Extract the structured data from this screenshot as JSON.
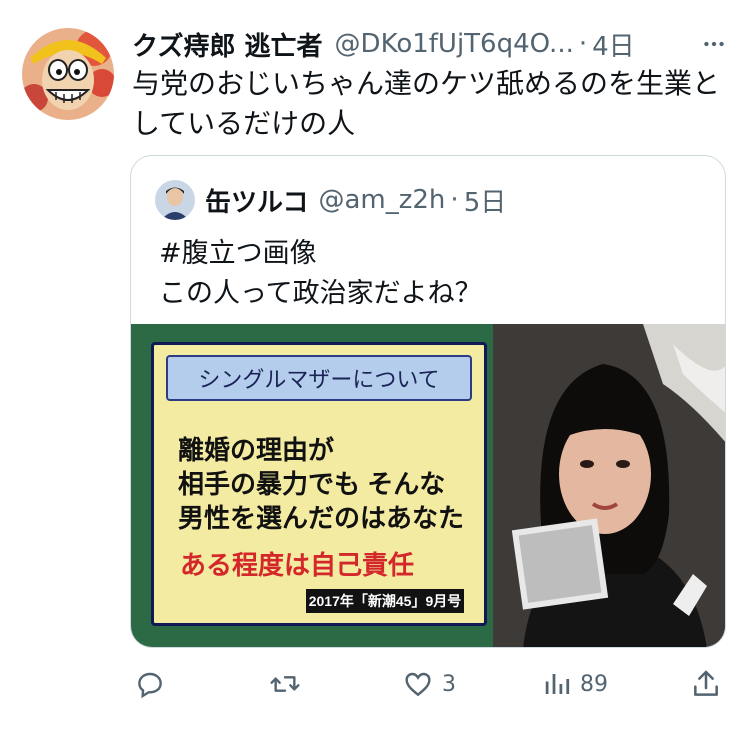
{
  "tweet": {
    "display_name": "クズ痔郎 逃亡者",
    "handle": "@DKo1fUjT6q4O...",
    "dot": "·",
    "time": "4日",
    "text_line1": "与党のおじいちゃん達のケツ舐めるのを生業と",
    "text_line2": "しているだけの人",
    "more_icon": "more-horizontal-icon"
  },
  "quote": {
    "display_name": "缶ツルコ",
    "handle": "@am_z2h",
    "dot": "·",
    "time": "5日",
    "text_line1": "#腹立つ画像",
    "text_line2": "この人って政治家だよね？",
    "media": {
      "panel_title": "シングルマザーについて",
      "body_line1": "離婚の理由が",
      "body_line2": "相手の暴力でも そんな",
      "body_line3": "男性を選んだのはあなた",
      "emphasis": "ある程度は自己責任",
      "source": "2017年「新潮45」9月号"
    }
  },
  "actions": {
    "reply_icon": "reply-icon",
    "retweet_icon": "retweet-icon",
    "like_icon": "heart-icon",
    "like_count": "3",
    "views_icon": "views-chart-icon",
    "views_count": "89",
    "share_icon": "share-icon"
  },
  "colors": {
    "text": "#0f1419",
    "secondary": "#536471",
    "border": "#cfd9de",
    "emphasis_red": "#d3272a",
    "panel_yellow": "#f3eba1",
    "panel_blue": "#b4cdec",
    "media_green": "#2c6a45"
  }
}
